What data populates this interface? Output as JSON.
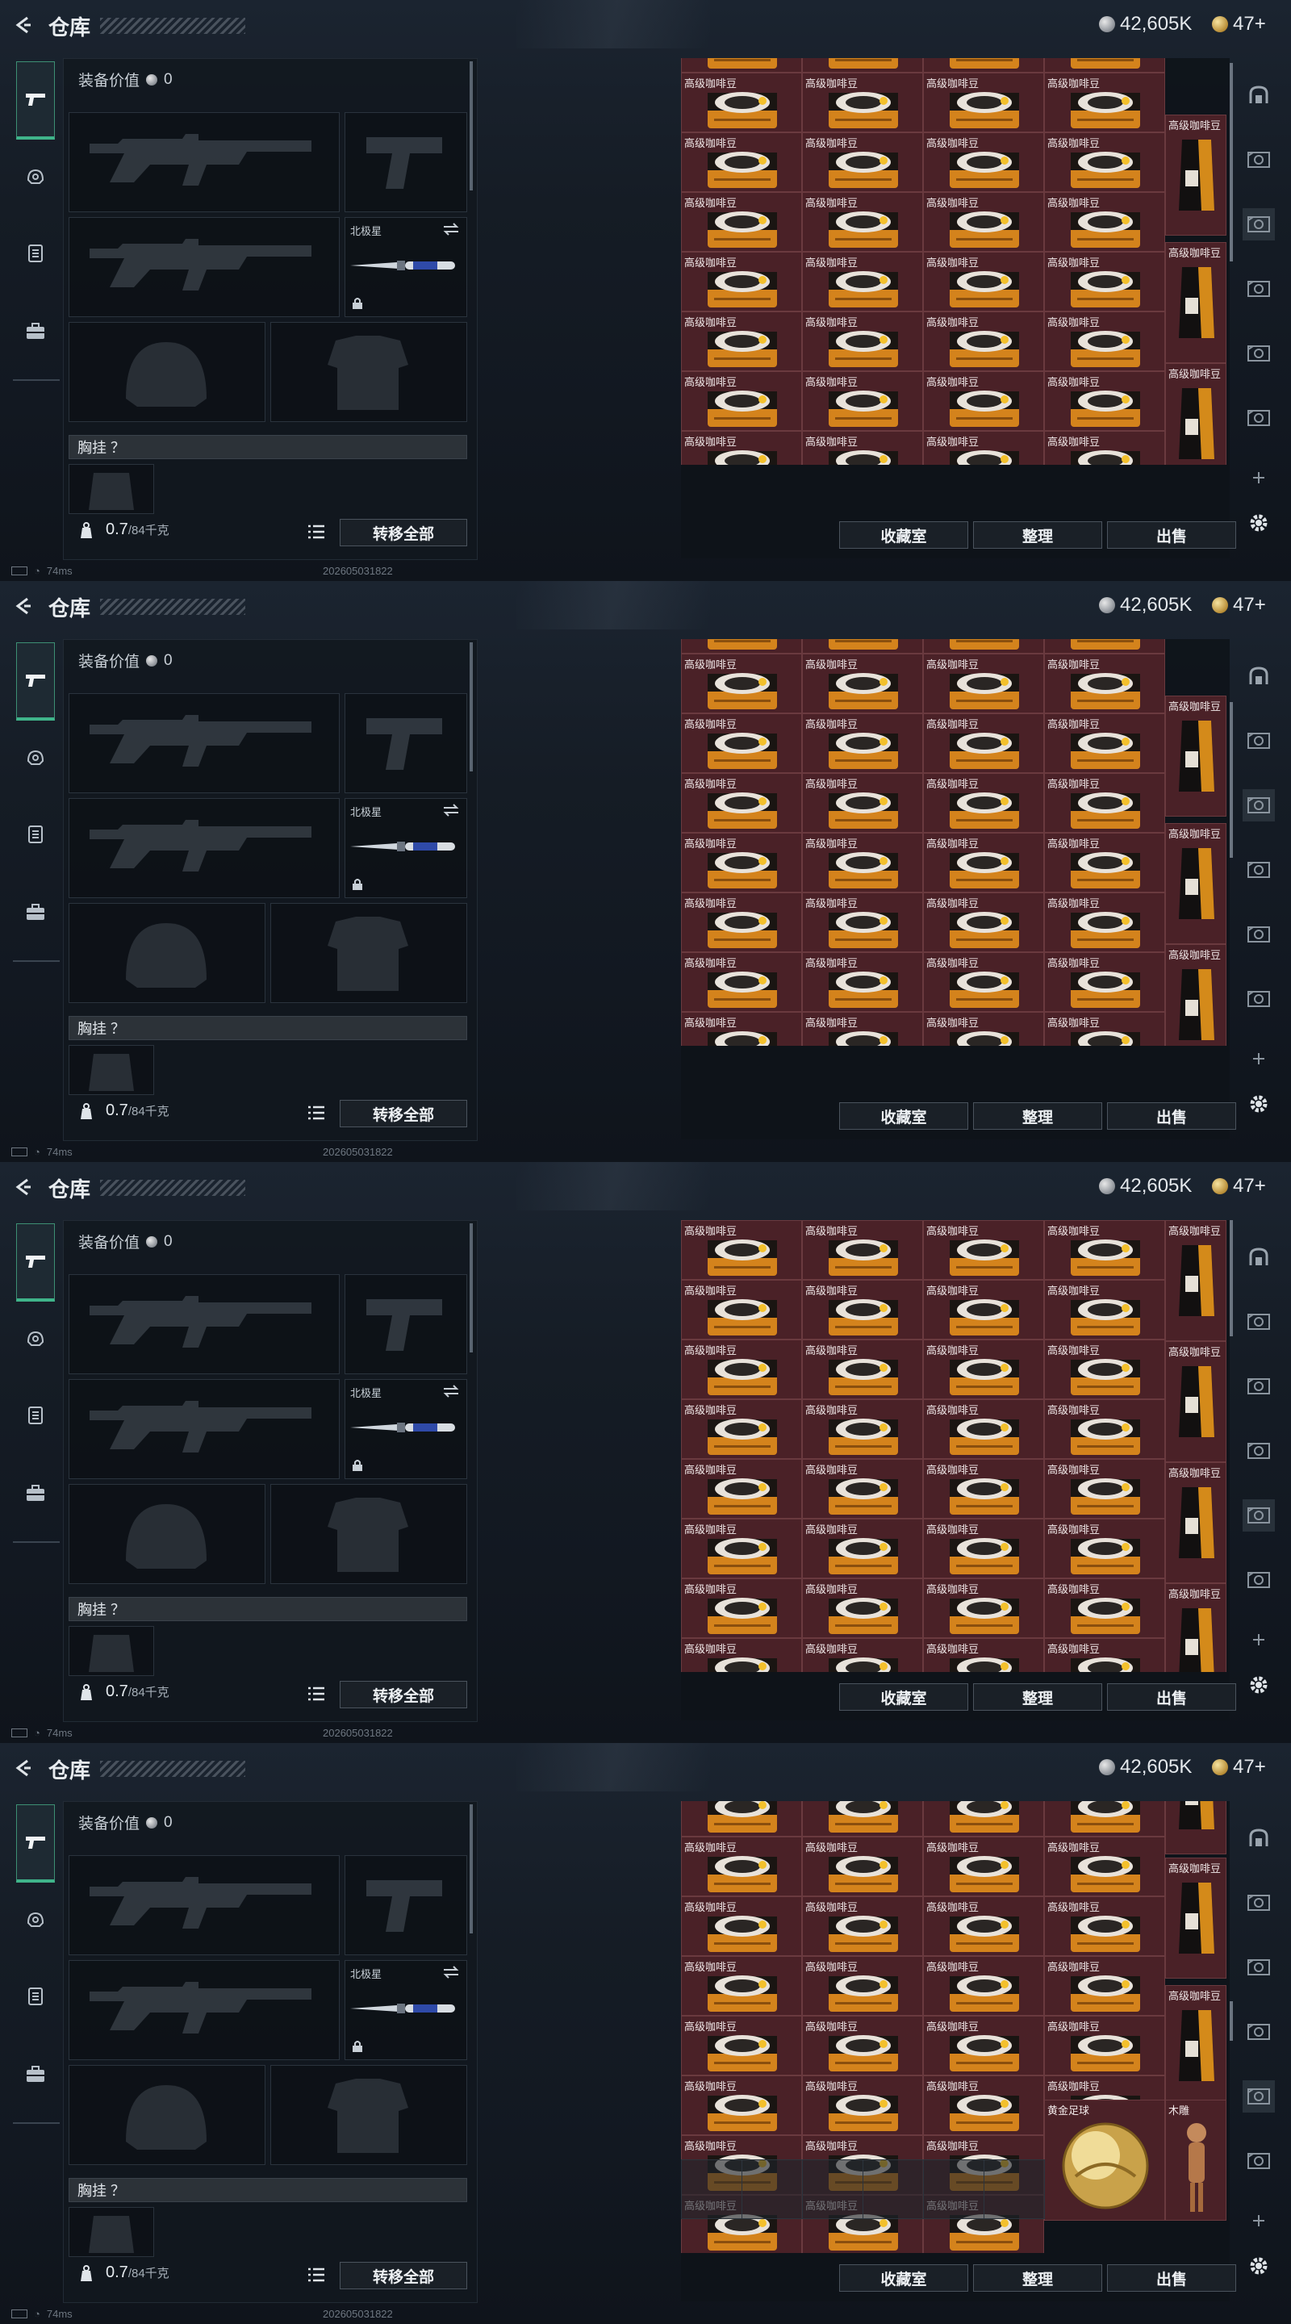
{
  "title": "仓库",
  "currency": {
    "silver": "42,605K",
    "gold": "47+"
  },
  "equipment": {
    "value_label": "装备价值",
    "value": "0",
    "melee_name": "北极星",
    "chest_label": "胸挂 ？",
    "weight_current": "0.7",
    "weight_max": "/84千克",
    "transfer_all": "转移全部"
  },
  "stash": {
    "item_coffee": "高级咖啡豆",
    "item_football": "黄金足球",
    "item_carving": "木雕",
    "collection_button": "收藏室",
    "sort_button": "整理",
    "sell_button": "出售"
  },
  "status": {
    "ping": "74ms",
    "timestamp": "202605031822"
  },
  "colors": {
    "accent": "#3fb48a",
    "item_bg": "#4a2127"
  },
  "icons": [
    "back-icon",
    "pistol-icon",
    "helmet-icon",
    "armor-icon",
    "backpack-icon",
    "lock-icon",
    "swap-icon",
    "list-icon",
    "gear-icon",
    "plus-icon",
    "safe-icon",
    "stash-icon"
  ]
}
